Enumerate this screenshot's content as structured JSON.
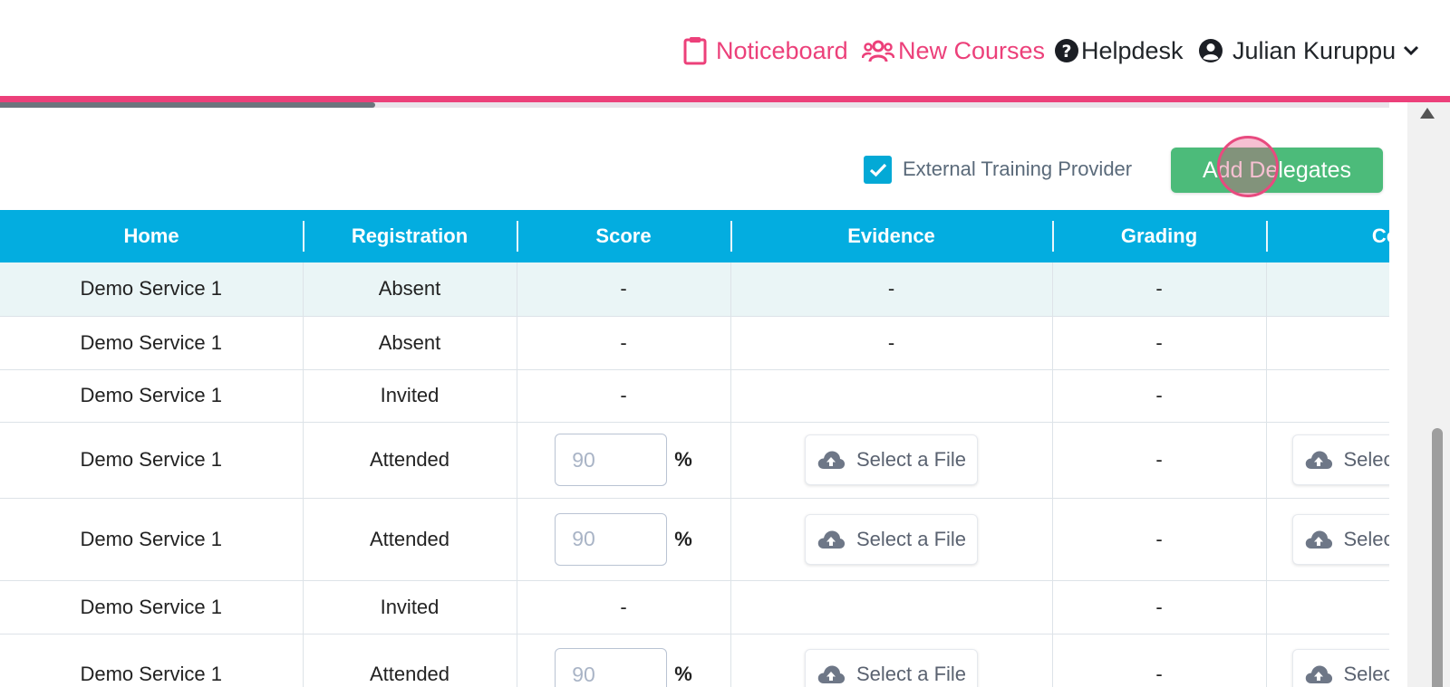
{
  "nav": {
    "noticeboard": "Noticeboard",
    "new_courses": "New Courses",
    "helpdesk": "Helpdesk",
    "user_name": "Julian Kuruppu"
  },
  "progress": {
    "fraction": 0.27
  },
  "toolbar": {
    "external_training_provider": "External Training Provider",
    "external_checked": true,
    "add_delegates": "Add Delegates"
  },
  "table": {
    "headers": [
      "Home",
      "Registration",
      "Score",
      "Evidence",
      "Grading",
      "Co"
    ],
    "rows": [
      {
        "home": "Demo Service 1",
        "registration": "Absent",
        "score": "-",
        "evidence": "-",
        "grading": "-"
      },
      {
        "home": "Demo Service 1",
        "registration": "Absent",
        "score": "-",
        "evidence": "-",
        "grading": "-"
      },
      {
        "home": "Demo Service 1",
        "registration": "Invited",
        "score": "-",
        "evidence": "",
        "grading": "-"
      },
      {
        "home": "Demo Service 1",
        "registration": "Attended",
        "score_value": "90",
        "score_unit": "%",
        "evidence_button": "Select a File",
        "grading": "-",
        "extra_button": "Selec"
      },
      {
        "home": "Demo Service 1",
        "registration": "Attended",
        "score_value": "90",
        "score_unit": "%",
        "evidence_button": "Select a File",
        "grading": "-",
        "extra_button": "Selec"
      },
      {
        "home": "Demo Service 1",
        "registration": "Invited",
        "score": "-",
        "evidence": "",
        "grading": "-"
      },
      {
        "home": "Demo Service 1",
        "registration": "Attended",
        "score_value": "90",
        "score_unit": "%",
        "evidence_button": "Select a File",
        "grading": "-",
        "extra_button": "Selec"
      }
    ]
  },
  "colors": {
    "brand_pink": "#ec407a",
    "header_blue": "#03ade0",
    "button_green": "#4cbb7a"
  }
}
